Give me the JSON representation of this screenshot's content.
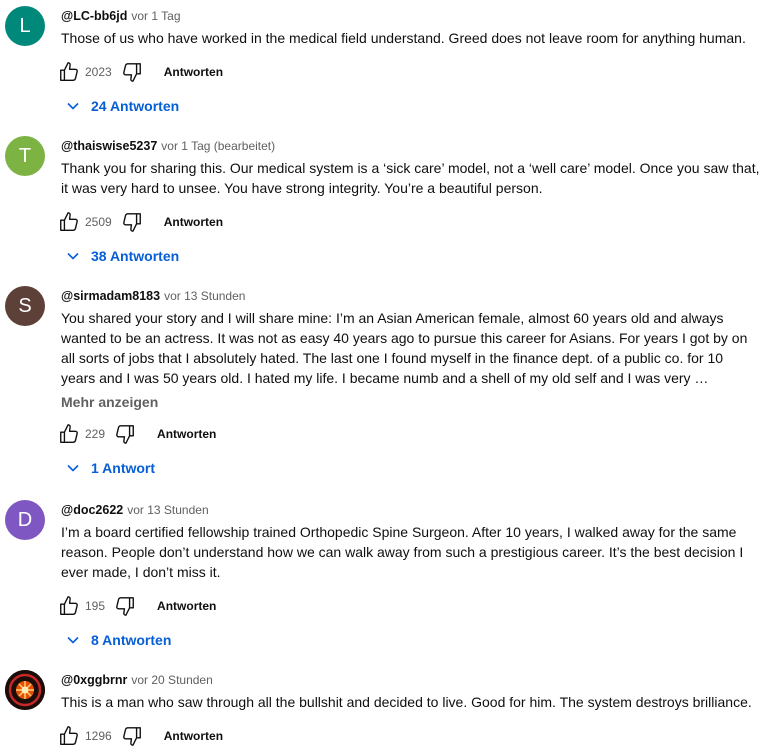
{
  "comments": [
    {
      "avatar_letter": "L",
      "avatar_color": "#00897b",
      "author": "@LC-bb6jd",
      "time": "vor 1 Tag",
      "lines": [
        "Those of us who have worked in the medical field understand. Greed does not leave room for anything human."
      ],
      "likes": "2023",
      "reply_label": "Antworten",
      "replies_label": "24 Antworten"
    },
    {
      "avatar_letter": "T",
      "avatar_color": "#7cb342",
      "author": "@thaiswise5237",
      "time": "vor 1 Tag (bearbeitet)",
      "lines": [
        "Thank you for sharing this. Our medical system is a ‘sick care’ model, not a ‘well care’ model. Once you saw that,",
        "it was very hard to unsee. You have strong integrity. You’re a beautiful person."
      ],
      "likes": "2509",
      "reply_label": "Antworten",
      "replies_label": "38 Antworten"
    },
    {
      "avatar_letter": "S",
      "avatar_color": "#5d4037",
      "author": "@sirmadam8183",
      "time": "vor 13 Stunden",
      "lines": [
        "You shared your story and I will share mine:  I’m an Asian American female, almost 60 years old and always",
        "wanted to be an actress.  It was not as easy 40 years ago to pursue this career for Asians.  For years I got by on",
        "all sorts of jobs that I absolutely hated.  The last one I found myself in the finance dept. of a public co. for 10",
        "years and I was 50 years old.  I hated my life. I became numb and a shell of my old self  and I was very …"
      ],
      "more_label": "Mehr anzeigen",
      "likes": "229",
      "reply_label": "Antworten",
      "replies_label": "1 Antwort"
    },
    {
      "avatar_letter": "D",
      "avatar_color": "#7e57c2",
      "author": "@doc2622",
      "time": "vor 13 Stunden",
      "lines": [
        "I’m a board certified fellowship trained Orthopedic Spine Surgeon. After 10 years, I walked away for the same",
        "reason.  People don’t understand how we can walk away from such a prestigious career.  It’s the best decision I",
        "ever made, I don’t miss it."
      ],
      "likes": "195",
      "reply_label": "Antworten",
      "replies_label": "8 Antworten"
    },
    {
      "avatar_letter": "",
      "avatar_color": "#1a0d0a",
      "author": "@0xggbrnr",
      "time": "vor 20 Stunden",
      "lines": [
        "This is a man who saw through all the bullshit and decided to live. Good for him. The system destroys brilliance."
      ],
      "likes": "1296",
      "reply_label": "Antworten"
    }
  ]
}
